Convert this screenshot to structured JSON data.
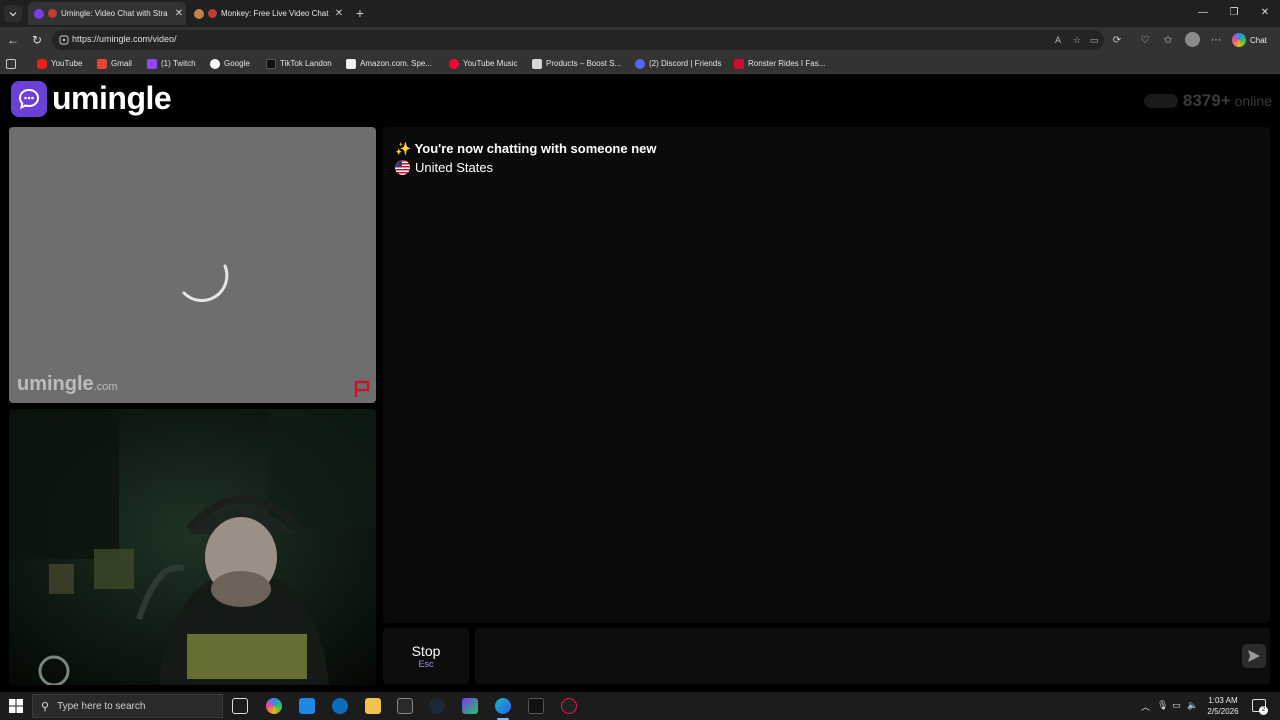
{
  "browser": {
    "tabs": [
      {
        "title": "Umingle: Video Chat with Stra",
        "active": true
      },
      {
        "title": "Monkey: Free Live Video Chat",
        "active": false
      }
    ],
    "new_tab_label": "+",
    "url": "https://umingle.com/video/",
    "copilot_label": "Chat",
    "bookmarks": [
      {
        "label": "YouTube"
      },
      {
        "label": "Gmail"
      },
      {
        "label": "(1) Twitch"
      },
      {
        "label": "Google"
      },
      {
        "label": "TikTok Landon"
      },
      {
        "label": "Amazon.com. Spe..."
      },
      {
        "label": "YouTube Music"
      },
      {
        "label": "Products – Boost S..."
      },
      {
        "label": "(2) Discord | Friends"
      },
      {
        "label": "Ronster Rides I Fas..."
      }
    ]
  },
  "site": {
    "logo_text": "umingle",
    "online_count": "8379+",
    "online_label": "online",
    "watermark_brand": "umingle",
    "watermark_tld": ".com"
  },
  "chat": {
    "system_message": "✨ You're now chatting with someone new",
    "country": "United States",
    "input_placeholder": "",
    "stop_label": "Stop",
    "stop_shortcut": "Esc"
  },
  "taskbar": {
    "search_placeholder": "Type here to search",
    "time": "1:03 AM",
    "date": "2/5/2026",
    "notification_count": "2"
  },
  "colors": {
    "brand_purple": "#6c3fd6",
    "shortcut_purple": "#a78bfa",
    "panel_bg": "#0a0a0a"
  }
}
